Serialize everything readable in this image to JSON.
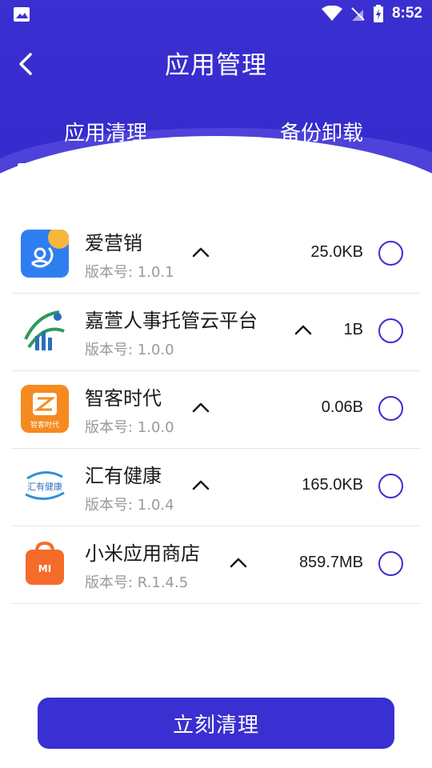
{
  "status_bar": {
    "time": "8:52"
  },
  "header": {
    "title": "应用管理"
  },
  "tabs": [
    {
      "label": "应用清理",
      "active": true
    },
    {
      "label": "备份卸载",
      "active": false
    }
  ],
  "apps": [
    {
      "name": "爱营销",
      "version": "版本号: 1.0.1",
      "size": "25.0KB",
      "icon": "aiyingxiao-app-icon"
    },
    {
      "name": "嘉萱人事托管云平台",
      "version": "版本号: 1.0.0",
      "size": "1B",
      "icon": "jiaxuan-app-icon"
    },
    {
      "name": "智客时代",
      "version": "版本号: 1.0.0",
      "size": "0.06B",
      "icon": "zhike-app-icon",
      "icon_text": "智客时代"
    },
    {
      "name": "汇有健康",
      "version": "版本号: 1.0.4",
      "size": "165.0KB",
      "icon": "huiyou-app-icon",
      "icon_text": "汇有健康"
    },
    {
      "name": "小米应用商店",
      "version": "版本号: R.1.4.5",
      "size": "859.7MB",
      "icon": "xiaomi-store-app-icon",
      "icon_text": "MI"
    }
  ],
  "actions": {
    "clean_label": "立刻清理"
  },
  "colors": {
    "primary": "#3a2fd0",
    "text": "#1a1a1a",
    "muted": "#9a9a9a"
  }
}
